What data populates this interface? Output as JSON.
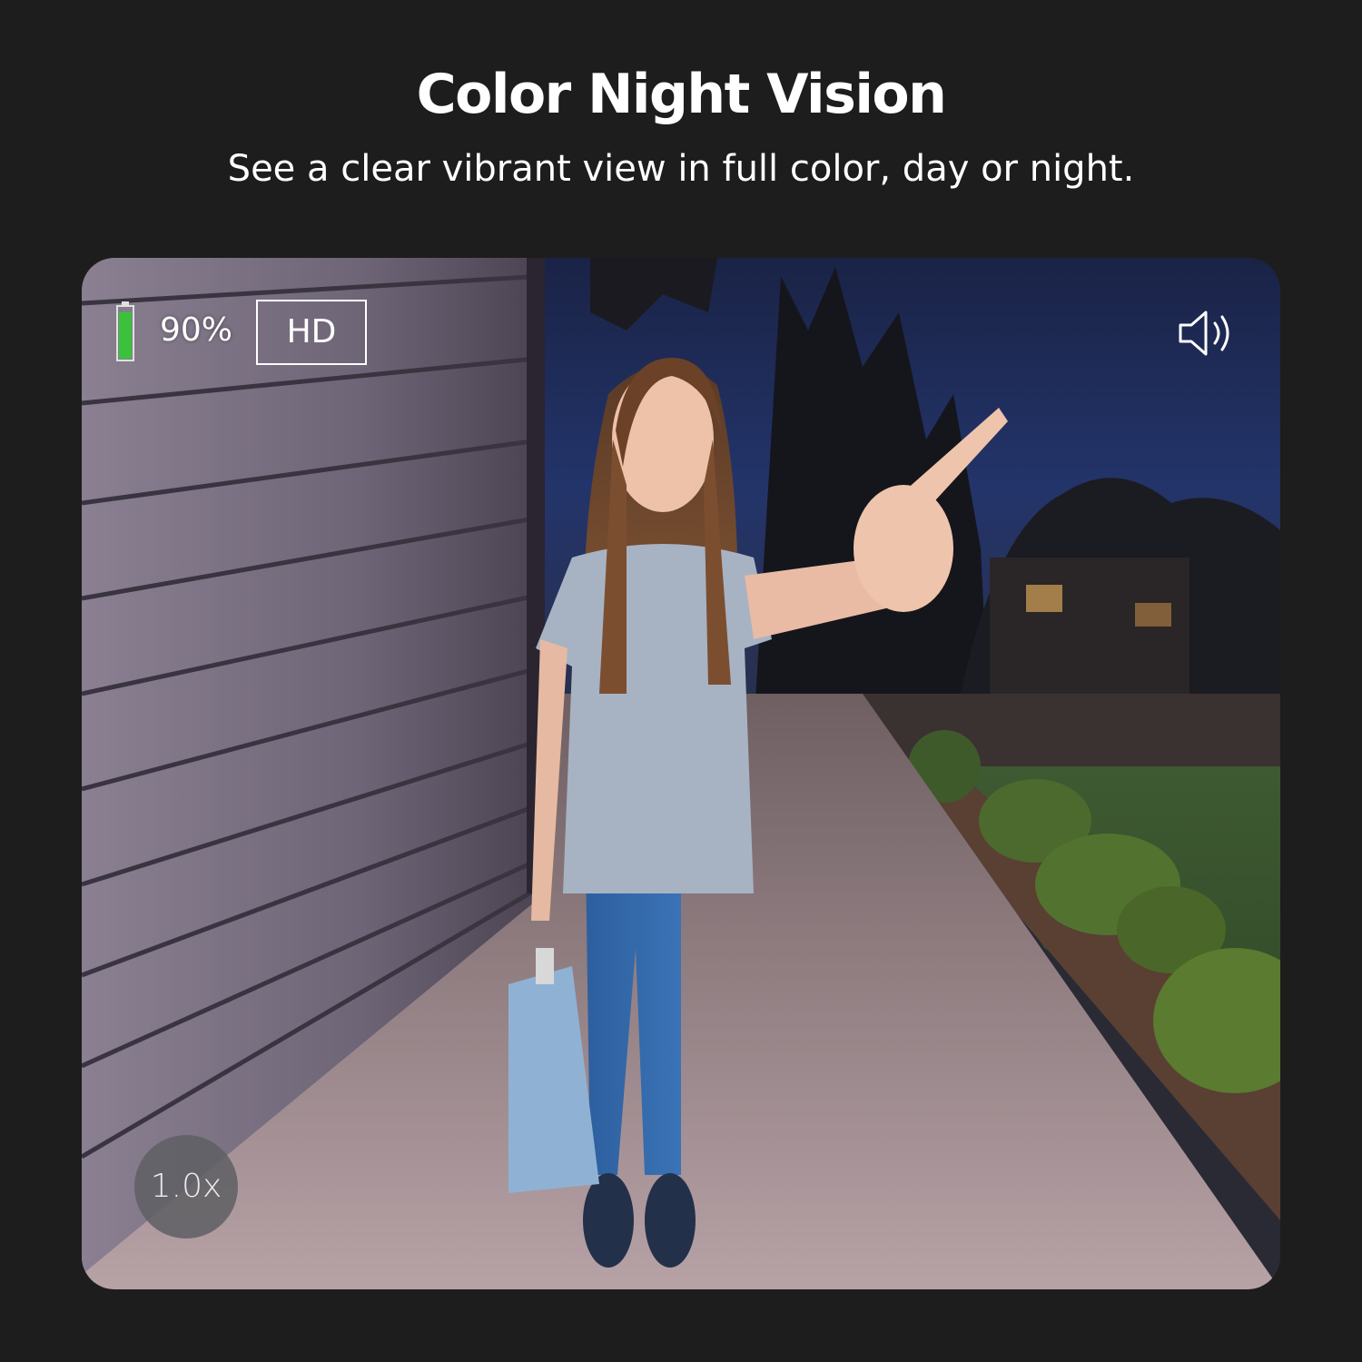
{
  "header": {
    "title": "Color Night Vision",
    "subtitle": "See a clear vibrant view in full color, day or night."
  },
  "viewer": {
    "battery": {
      "percent_label": "90%",
      "level": 0.9,
      "fill_color": "#3cc13c"
    },
    "quality_badge": "HD",
    "speaker_icon": "speaker-volume-icon",
    "zoom_label": "1.0x"
  },
  "colors": {
    "page_background": "#1d1d1d",
    "text": "#ffffff"
  }
}
